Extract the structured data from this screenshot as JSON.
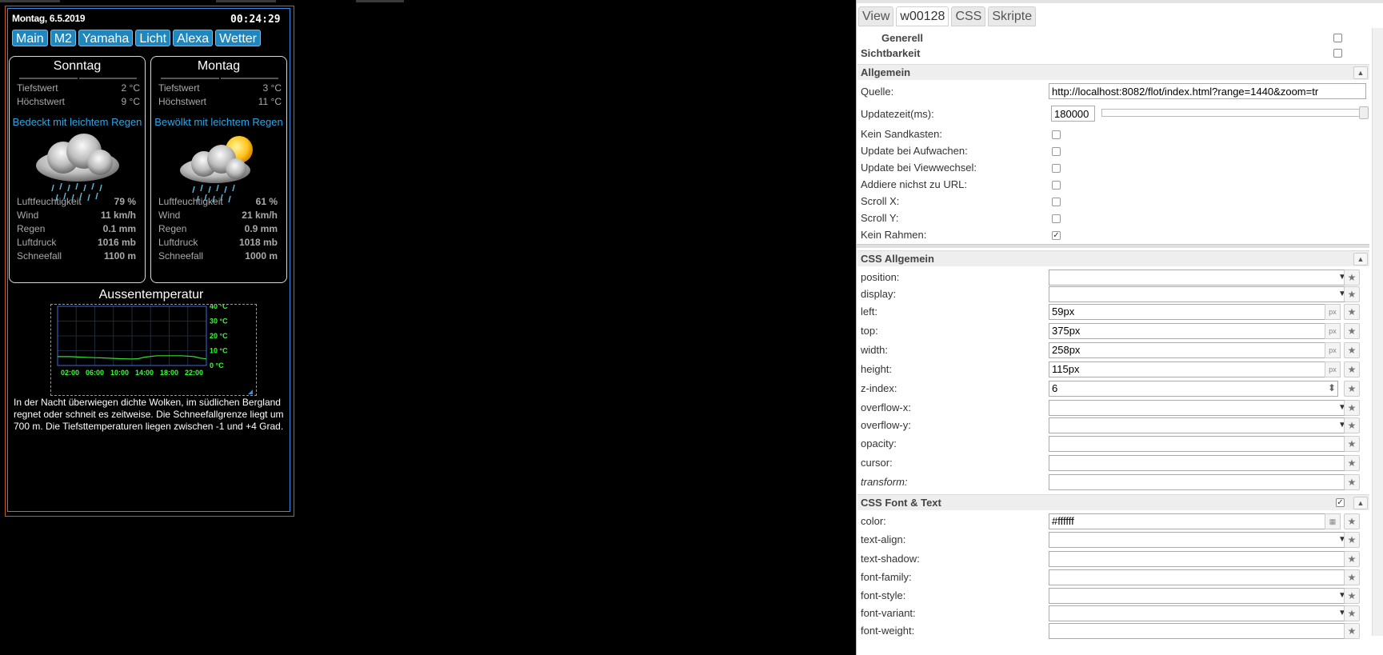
{
  "header": {
    "date": "Montag, 6.5.2019",
    "time": "00:24:29"
  },
  "nav": {
    "items": [
      "Main",
      "M2",
      "Yamaha",
      "Licht",
      "Alexa",
      "Wetter"
    ]
  },
  "days": [
    {
      "title": "Sonntag",
      "min_label": "Tiefstwert",
      "min_value": "2 °C",
      "max_label": "Höchstwert",
      "max_value": "9 °C",
      "description": "Bedeckt mit leichtem Regen",
      "icon": "cloud-rain-icon",
      "stats": [
        {
          "label": "Luftfeuchtigkeit",
          "value": "79 %"
        },
        {
          "label": "Wind",
          "value": "11 km/h"
        },
        {
          "label": "Regen",
          "value": "0.1 mm"
        },
        {
          "label": "Luftdruck",
          "value": "1016 mb"
        },
        {
          "label": "Schneefall",
          "value": "1100 m"
        }
      ]
    },
    {
      "title": "Montag",
      "min_label": "Tiefstwert",
      "min_value": "3 °C",
      "max_label": "Höchstwert",
      "max_value": "11 °C",
      "description": "Bewölkt mit leichtem Regen",
      "icon": "sun-cloud-rain-icon",
      "stats": [
        {
          "label": "Luftfeuchtigkeit",
          "value": "61 %"
        },
        {
          "label": "Wind",
          "value": "21 km/h"
        },
        {
          "label": "Regen",
          "value": "0.9 mm"
        },
        {
          "label": "Luftdruck",
          "value": "1018 mb"
        },
        {
          "label": "Schneefall",
          "value": "1000 m"
        }
      ]
    }
  ],
  "chart_title": "Aussentemperatur",
  "chart_data": {
    "type": "line",
    "title": "",
    "xlabel": "",
    "ylabel": "",
    "x_ticks": [
      "02:00",
      "06:00",
      "10:00",
      "14:00",
      "18:00",
      "22:00"
    ],
    "y_ticks": [
      "0 °C",
      "10 °C",
      "20 °C",
      "30 °C",
      "40 °C"
    ],
    "ylim": [
      0,
      40
    ],
    "xlim": [
      0,
      24
    ],
    "grid": true,
    "series": [
      {
        "x": [
          0,
          2,
          4,
          6,
          8,
          10,
          12,
          13,
          14,
          16,
          18,
          20,
          22,
          23,
          24
        ],
        "y": [
          6,
          6,
          5.6,
          5.3,
          5,
          4.6,
          4.4,
          4.6,
          5.6,
          6.6,
          6.6,
          6.6,
          6,
          5,
          4.5
        ]
      }
    ],
    "colors": {
      "line": "#33dd33",
      "axis": "#3b6cd6",
      "ticks": "#33ff33"
    }
  },
  "forecast_text": "In der Nacht überwiegen dichte Wolken, im südlichen Bergland regnet oder schneit es zeitweise. Die Schneefallgrenze liegt um 700 m. Die Tiefsttemperaturen liegen zwischen -1 und +4 Grad.",
  "inspector": {
    "tabs": [
      "View",
      "w00128",
      "CSS",
      "Skripte"
    ],
    "sections": {
      "generell": "Generell",
      "sichtbarkeit": "Sichtbarkeit",
      "allgemein": "Allgemein",
      "css_allgemein": "CSS Allgemein",
      "css_font": "CSS Font & Text"
    },
    "fields": {
      "quelle_label": "Quelle:",
      "quelle_value": "http://localhost:8082/flot/index.html?range=1440&zoom=tr",
      "update_label": "Updatezeit(ms):",
      "update_value": "180000",
      "checkboxes": [
        {
          "label": "Kein Sandkasten:",
          "checked": false
        },
        {
          "label": "Update bei Aufwachen:",
          "checked": false
        },
        {
          "label": "Update bei Viewwechsel:",
          "checked": false
        },
        {
          "label": "Addiere nichst zu URL:",
          "checked": false
        },
        {
          "label": "Scroll X:",
          "checked": false
        },
        {
          "label": "Scroll Y:",
          "checked": false
        },
        {
          "label": "Kein Rahmen:",
          "checked": true
        }
      ]
    },
    "css": [
      {
        "label": "position:",
        "value": "",
        "kind": "select"
      },
      {
        "label": "display:",
        "value": "",
        "kind": "select"
      },
      {
        "label": "left:",
        "value": "59px",
        "kind": "px"
      },
      {
        "label": "top:",
        "value": "375px",
        "kind": "px"
      },
      {
        "label": "width:",
        "value": "258px",
        "kind": "px"
      },
      {
        "label": "height:",
        "value": "115px",
        "kind": "px"
      },
      {
        "label": "z-index:",
        "value": "6",
        "kind": "spin"
      },
      {
        "label": "overflow-x:",
        "value": "",
        "kind": "select"
      },
      {
        "label": "overflow-y:",
        "value": "",
        "kind": "select"
      },
      {
        "label": "opacity:",
        "value": "",
        "kind": "text"
      },
      {
        "label": "cursor:",
        "value": "",
        "kind": "text"
      },
      {
        "label": "transform:",
        "value": "",
        "kind": "text"
      }
    ],
    "font": [
      {
        "label": "color:",
        "value": "#ffffff",
        "kind": "color"
      },
      {
        "label": "text-align:",
        "value": "",
        "kind": "select"
      },
      {
        "label": "text-shadow:",
        "value": "",
        "kind": "text"
      },
      {
        "label": "font-family:",
        "value": "",
        "kind": "text"
      },
      {
        "label": "font-style:",
        "value": "",
        "kind": "select"
      },
      {
        "label": "font-variant:",
        "value": "",
        "kind": "select"
      },
      {
        "label": "font-weight:",
        "value": "",
        "kind": "text"
      }
    ]
  }
}
